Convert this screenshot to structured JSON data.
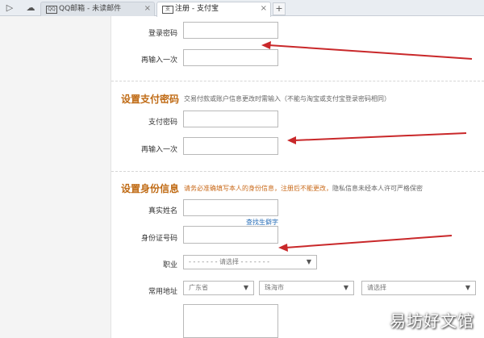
{
  "browser": {
    "tabs": [
      {
        "label": "QQ邮箱 - 未读邮件",
        "favicon": "QQ"
      },
      {
        "label": "注册 - 支付宝",
        "favicon": "支"
      }
    ],
    "close_glyph": "×",
    "new_tab_glyph": "+"
  },
  "form": {
    "login_password_label": "登录密码",
    "login_password_confirm_label": "再输入一次",
    "pay_section": {
      "title": "设置支付密码",
      "note": "交易付款或账户信息更改时需输入（不能与淘宝或支付宝登录密码相同）"
    },
    "pay_password_label": "支付密码",
    "pay_password_confirm_label": "再输入一次",
    "id_section": {
      "title": "设置身份信息",
      "note_warn": "请务必准确填写本人的身份信息，注册后不能更改，",
      "note_rest": "隐私信息未经本人许可严格保密"
    },
    "real_name_label": "真实姓名",
    "find_rare_char_link": "查找生僻字",
    "id_number_label": "身份证号码",
    "occupation_label": "职业",
    "occupation_select": "- - - - - - - 请选择 - - - - - - -",
    "address_label": "常用地址",
    "province_select": "广东省",
    "city_select": "珠海市",
    "district_select": "请选择"
  },
  "watermark": "易坊好文馆",
  "colors": {
    "accent_orange": "#c06b15",
    "annotation_red": "#c9282a",
    "link_blue": "#2a6fb8"
  }
}
